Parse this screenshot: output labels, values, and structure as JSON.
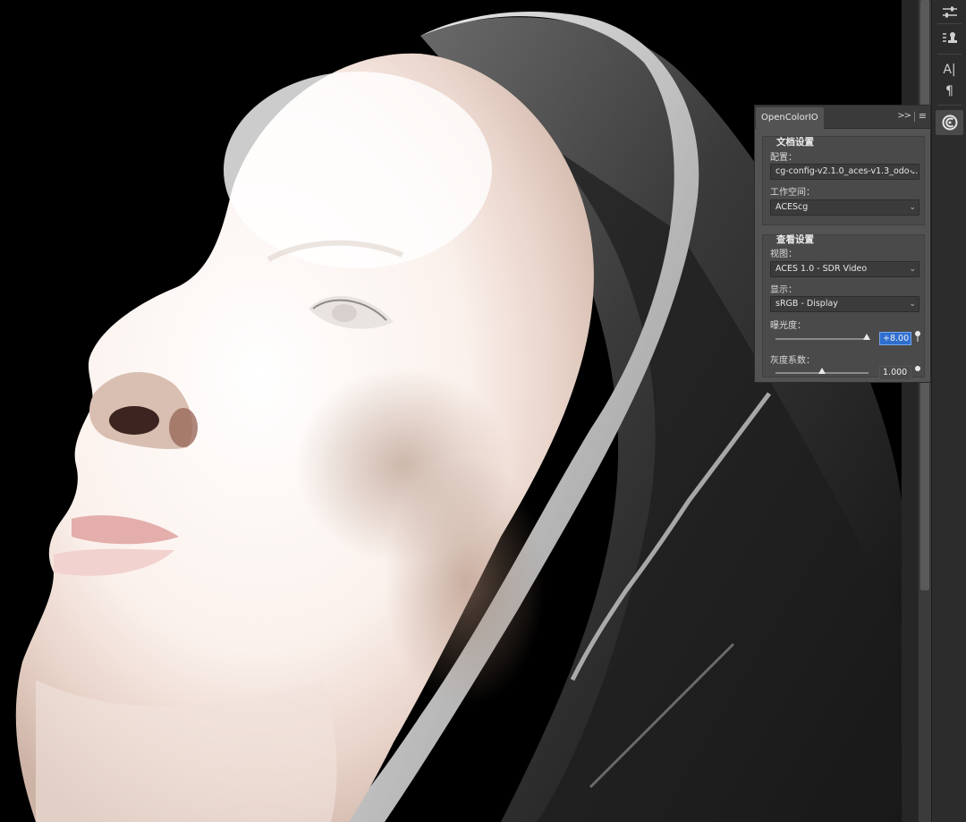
{
  "panel": {
    "tab_label": "OpenColorIO",
    "collapse_glyph": ">>",
    "menu_glyph": "≡",
    "document_settings": {
      "title": "文档设置",
      "config_label": "配置：",
      "config_value": "cg-config-v2.1.0_aces-v1.3_odo-...",
      "working_space_label": "工作空间：",
      "working_space_value": "ACEScg"
    },
    "view_settings": {
      "title": "查看设置",
      "view_label": "视图：",
      "view_value": "ACES 1.0 - SDR Video",
      "display_label": "显示：",
      "display_value": "sRGB - Display",
      "exposure_label": "曝光度：",
      "exposure_value": "+8.00",
      "exposure_slider_fraction": 0.98,
      "gamma_label": "灰度系数：",
      "gamma_value": "1.000",
      "gamma_slider_fraction": 0.5
    }
  },
  "dock": {
    "icons": [
      "sliders-icon",
      "stamp-list-icon",
      "character-icon",
      "paragraph-icon",
      "opencolorio-icon"
    ],
    "character_glyph": "A|",
    "paragraph_glyph": "¶"
  },
  "colors": {
    "panel_bg": "#535353",
    "dock_bg": "#2c2c2c",
    "selection_blue": "#2f6fd0"
  }
}
